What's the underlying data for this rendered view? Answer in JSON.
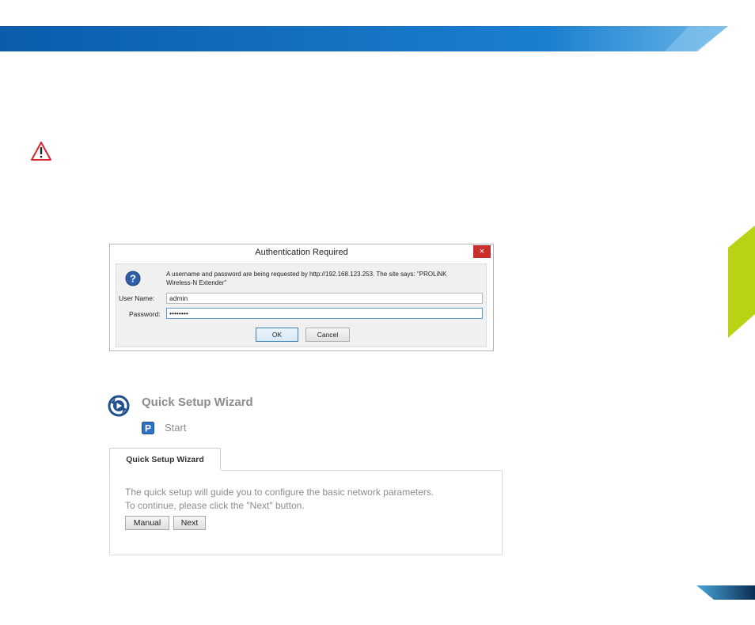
{
  "colors": {
    "banner_dark": "#0a5fb4",
    "banner_light": "#5aa6df",
    "green_tab": "#b9d213",
    "warning_red": "#d9262c",
    "close_red": "#c9302c",
    "muted_text": "#8c8c8c"
  },
  "icons": {
    "warning": "warning-triangle-icon",
    "help": "question-mark-icon",
    "close": "close-icon",
    "wizard": "play-refresh-icon",
    "start": "p-square-icon"
  },
  "auth_dialog": {
    "title": "Authentication Required",
    "close_glyph": "×",
    "message_line1": "A username and password are being requested by http://192.168.123.253. The site says: \"PROLiNK",
    "message_line2": "Wireless-N Extender\"",
    "username_label": "User Name:",
    "username_value": "admin",
    "password_label": "Password:",
    "password_value": "••••••••",
    "ok_label": "OK",
    "cancel_label": "Cancel"
  },
  "wizard": {
    "title": "Quick Setup Wizard",
    "start_label": "Start",
    "tab_label": "Quick Setup Wizard",
    "line1": "The quick setup will guide you to configure the basic network parameters.",
    "line2": "To continue, please click the \"Next\" button.",
    "manual_label": "Manual",
    "next_label": "Next"
  }
}
